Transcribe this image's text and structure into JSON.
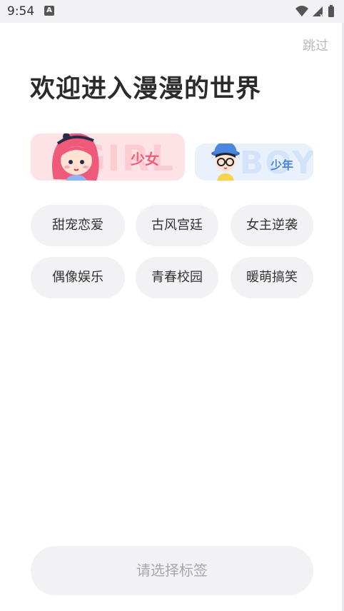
{
  "status_bar": {
    "time": "9:54",
    "notification_icon": "A",
    "icons": [
      "wifi-icon",
      "signal-icon",
      "battery-icon"
    ]
  },
  "header": {
    "skip_label": "跳过",
    "title": "欢迎进入漫漫的世界"
  },
  "gender": {
    "girl": {
      "label": "少女",
      "watermark": "GIRL",
      "selected": true
    },
    "boy": {
      "label": "少年",
      "watermark": "BOY",
      "selected": false
    }
  },
  "tags": [
    "甜宠恋爱",
    "古风宫廷",
    "女主逆袭",
    "偶像娱乐",
    "青春校园",
    "暖萌搞笑"
  ],
  "footer": {
    "submit_label": "请选择标签"
  },
  "colors": {
    "girl_bg": "#fde3e6",
    "girl_accent": "#ef5f7a",
    "boy_bg": "#e8f1fc",
    "boy_accent": "#4a86de",
    "chip_bg": "#f2f2f4",
    "muted_text": "#b8b8be"
  }
}
